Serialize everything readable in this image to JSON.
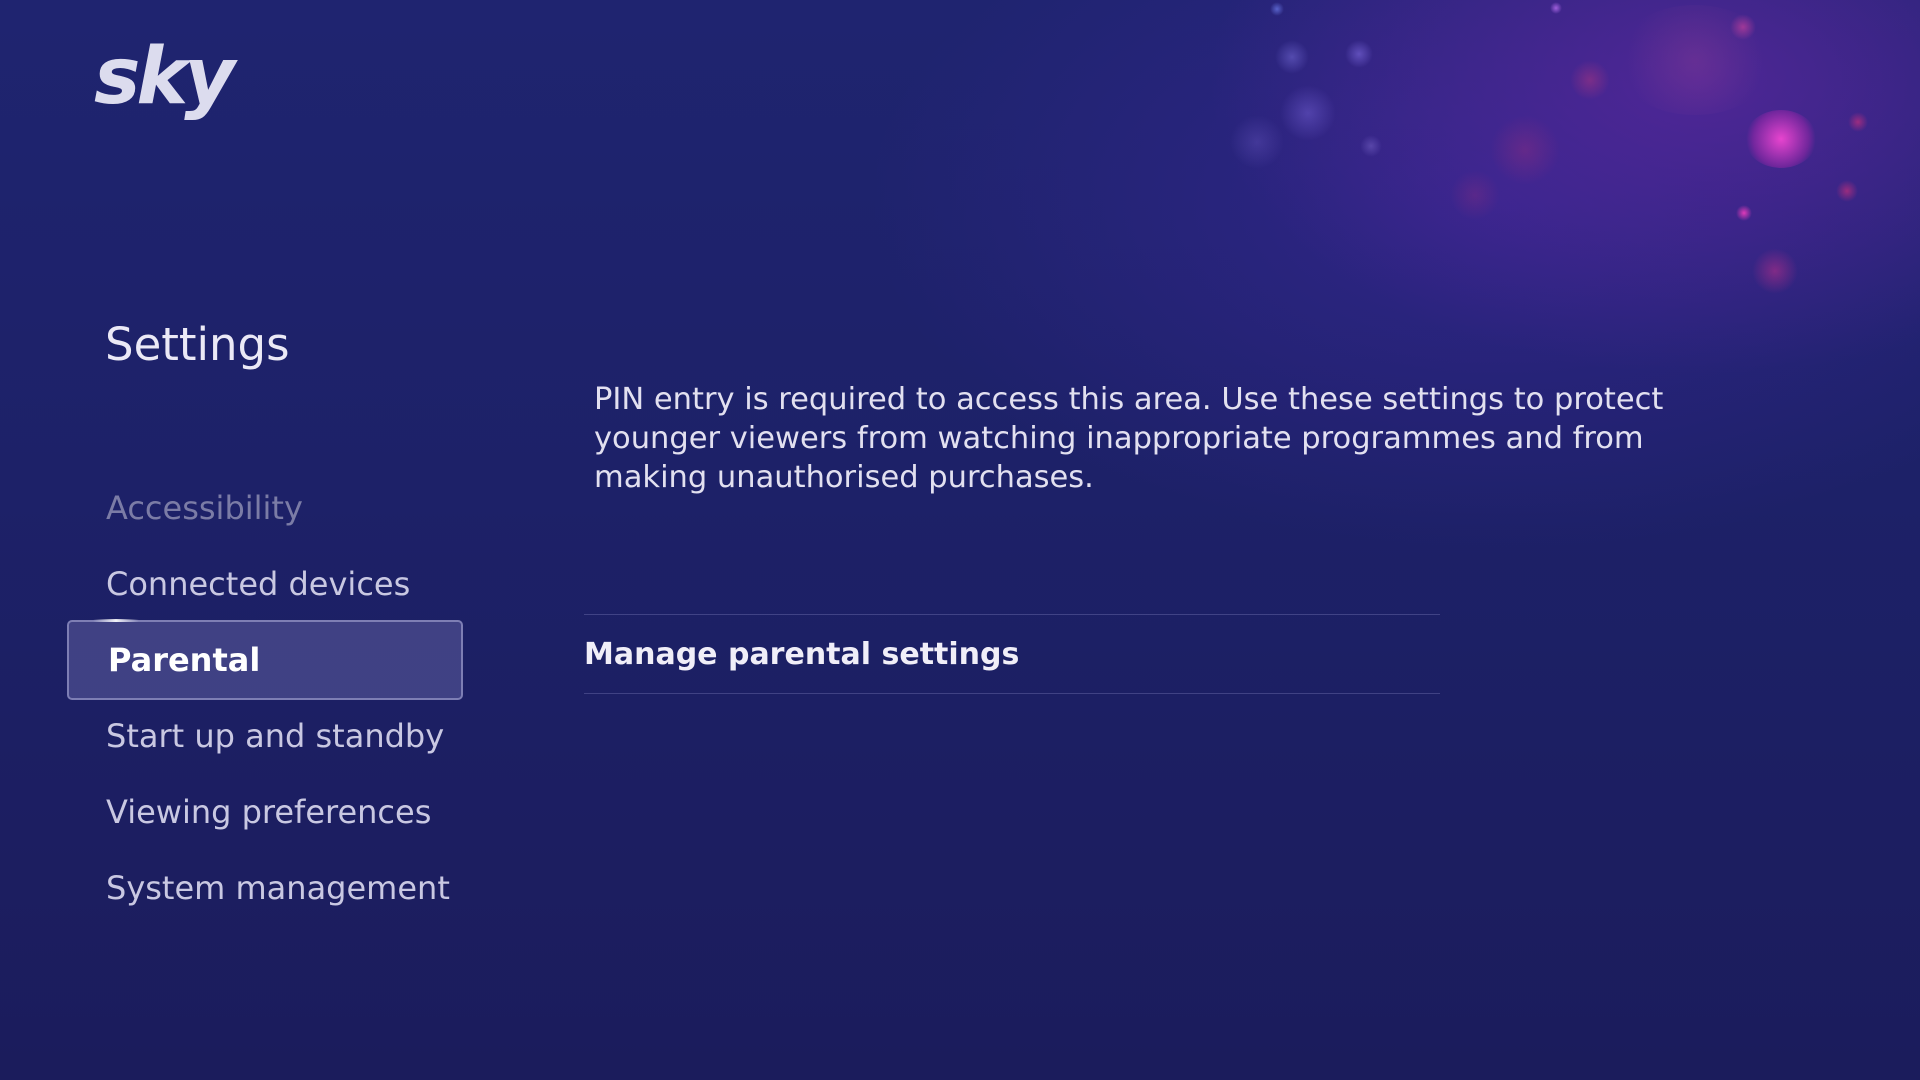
{
  "brand": {
    "logo_text": "sky"
  },
  "page": {
    "title": "Settings"
  },
  "sidebar": {
    "items": [
      {
        "label": "Accessibility",
        "state": "dimmed"
      },
      {
        "label": "Connected devices",
        "state": "normal"
      },
      {
        "label": "Parental",
        "state": "selected"
      },
      {
        "label": "Start up and standby",
        "state": "normal"
      },
      {
        "label": "Viewing preferences",
        "state": "normal"
      },
      {
        "label": "System management",
        "state": "normal"
      }
    ]
  },
  "main": {
    "description": "PIN entry is required to access this area. Use these settings to protect younger viewers from watching inappropriate programmes and from making unauthorised purchases.",
    "options": [
      {
        "label": "Manage parental settings"
      }
    ]
  },
  "colors": {
    "background": "#1d2168",
    "accent_pink": "#e02fb4",
    "selected_item_bg": "#5c5c9e"
  }
}
